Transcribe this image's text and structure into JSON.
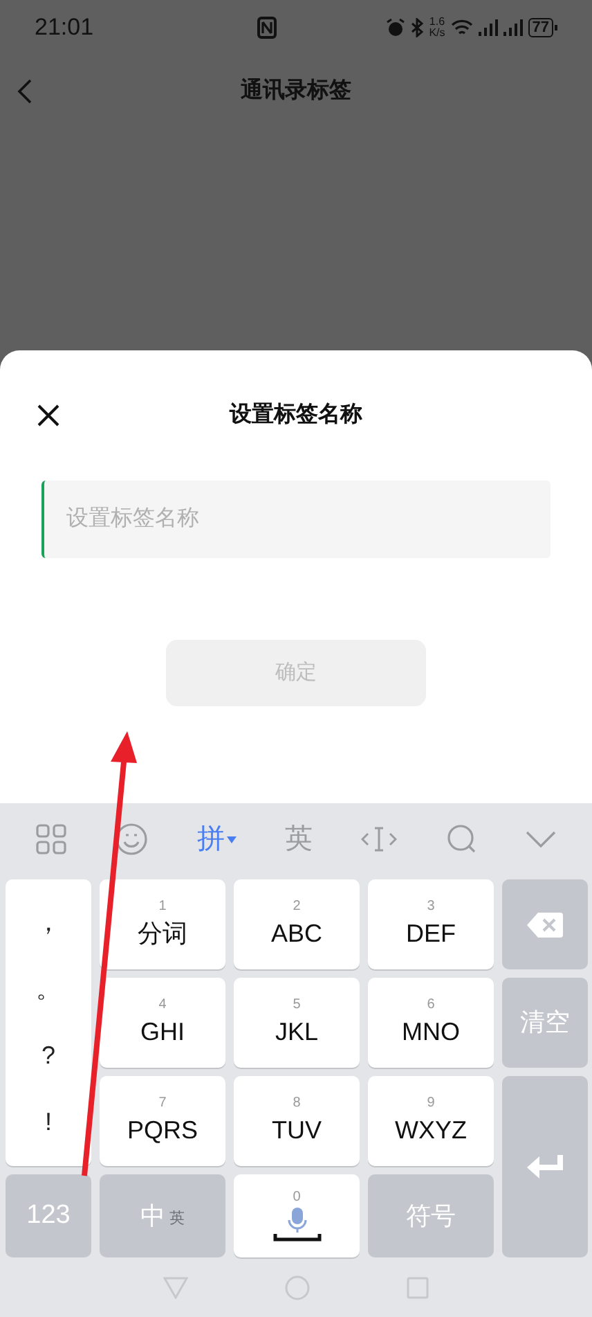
{
  "status_bar": {
    "time": "21:01",
    "net_speed": "1.6",
    "net_unit": "K/s",
    "battery": "77"
  },
  "header": {
    "title": "通讯录标签"
  },
  "dialog": {
    "title": "设置标签名称",
    "input": {
      "placeholder": "设置标签名称"
    },
    "confirm_button": {
      "label": "确定",
      "disabled": true
    }
  },
  "keyboard": {
    "input_modes": [
      {
        "label": "拼",
        "selected": true
      },
      {
        "label": "英",
        "selected": false
      }
    ],
    "punctuation": [
      "，",
      "。",
      "?",
      "!"
    ],
    "keys": [
      {
        "digit": "1",
        "label": "分词"
      },
      {
        "digit": "2",
        "label": "ABC"
      },
      {
        "digit": "3",
        "label": "DEF"
      },
      {
        "digit": "4",
        "label": "GHI"
      },
      {
        "digit": "5",
        "label": "JKL"
      },
      {
        "digit": "6",
        "label": "MNO"
      },
      {
        "digit": "7",
        "label": "PQRS"
      },
      {
        "digit": "8",
        "label": "TUV"
      },
      {
        "digit": "9",
        "label": "WXYZ"
      }
    ],
    "clear_key": "清空",
    "numbers_key": "123",
    "lang_key": {
      "primary": "中",
      "secondary": "英"
    },
    "space_key": {
      "digit": "0"
    },
    "symbols_key": "符号"
  }
}
